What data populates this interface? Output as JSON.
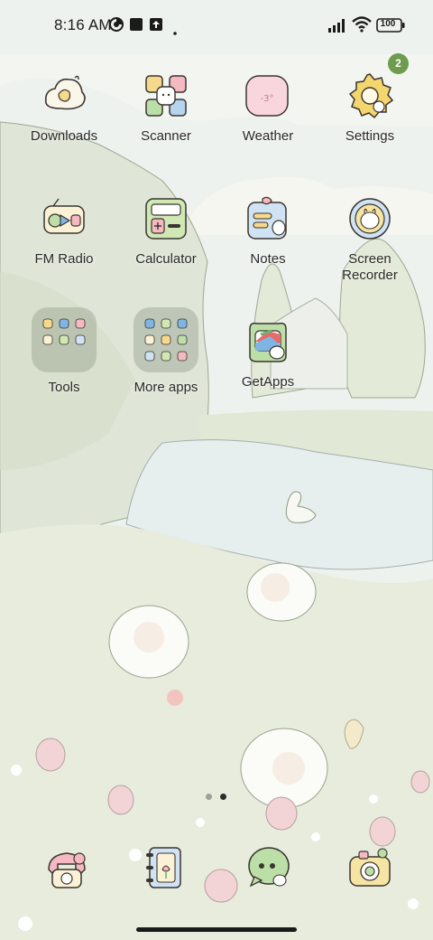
{
  "status_bar": {
    "time": "8:16 AM",
    "battery_level": "100",
    "left_icons": [
      "data-saver-icon",
      "notification-square-icon",
      "upload-icon",
      "dot-icon"
    ],
    "right_icons": [
      "cellular-signal-icon",
      "wifi-icon",
      "battery-icon"
    ]
  },
  "home": {
    "rows": [
      [
        {
          "label": "Downloads",
          "icon": "cloud-egg-icon"
        },
        {
          "label": "Scanner",
          "icon": "scanner-icon"
        },
        {
          "label": "Weather",
          "icon": "weather-icon"
        },
        {
          "label": "Settings",
          "icon": "gear-icon"
        }
      ],
      [
        {
          "label": "FM Radio",
          "icon": "radio-icon"
        },
        {
          "label": "Calculator",
          "icon": "calculator-icon"
        },
        {
          "label": "Notes",
          "icon": "notes-icon"
        },
        {
          "label": "Screen Recorder",
          "icon": "screen-recorder-icon"
        }
      ],
      [
        {
          "label": "Tools",
          "icon": "folder-icon"
        },
        {
          "label": "More apps",
          "icon": "folder-icon"
        },
        {
          "label": "GetApps",
          "icon": "getapps-icon"
        }
      ]
    ],
    "settings_badge": "2",
    "page_indicator": {
      "pages": 2,
      "current": 2
    }
  },
  "dock": [
    {
      "name": "phone",
      "icon": "phone-icon"
    },
    {
      "name": "contacts",
      "icon": "contacts-book-icon"
    },
    {
      "name": "messages",
      "icon": "chat-bubble-icon"
    },
    {
      "name": "camera",
      "icon": "camera-icon"
    }
  ],
  "colors": {
    "badge": "#6e9b4e",
    "label_text": "#2a2a2a",
    "status_text": "#1b1b1b",
    "wallpaper_meadow": "#e6ecdc",
    "wallpaper_sky": "#eef2ee",
    "wallpaper_pond": "#dde6e6"
  }
}
